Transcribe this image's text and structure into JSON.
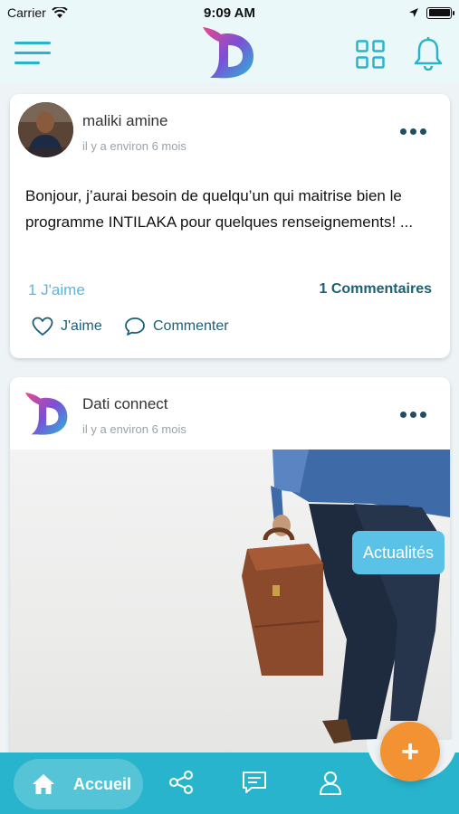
{
  "status_bar": {
    "carrier": "Carrier",
    "time": "9:09 AM"
  },
  "header": {
    "menu_icon": "hamburger-icon",
    "logo_icon": "dati-logo",
    "grid_icon": "grid-icon",
    "bell_icon": "bell-icon"
  },
  "posts": [
    {
      "author": "maliki amine",
      "time": "il y a environ 6 mois",
      "text": "Bonjour, j’aurai besoin de quelqu’un qui maitrise bien le programme INTILAKA pour quelques renseignements! ...",
      "likes_label": "1 J'aime",
      "comments_label": "1 Commentaires",
      "like_action": "J'aime",
      "comment_action": "Commenter"
    },
    {
      "author": "Dati connect",
      "time": "il y a environ 6 mois",
      "tag": "Actualités"
    }
  ],
  "bottom_nav": {
    "home_label": "Accueil",
    "items": [
      "home-icon",
      "share-icon",
      "chat-icon",
      "profile-icon"
    ]
  },
  "fab_label": "+",
  "colors": {
    "primary": "#27b4cc",
    "accent": "#f39232",
    "dark_teal": "#1d5f74",
    "tag_blue": "#5ac2e6"
  }
}
